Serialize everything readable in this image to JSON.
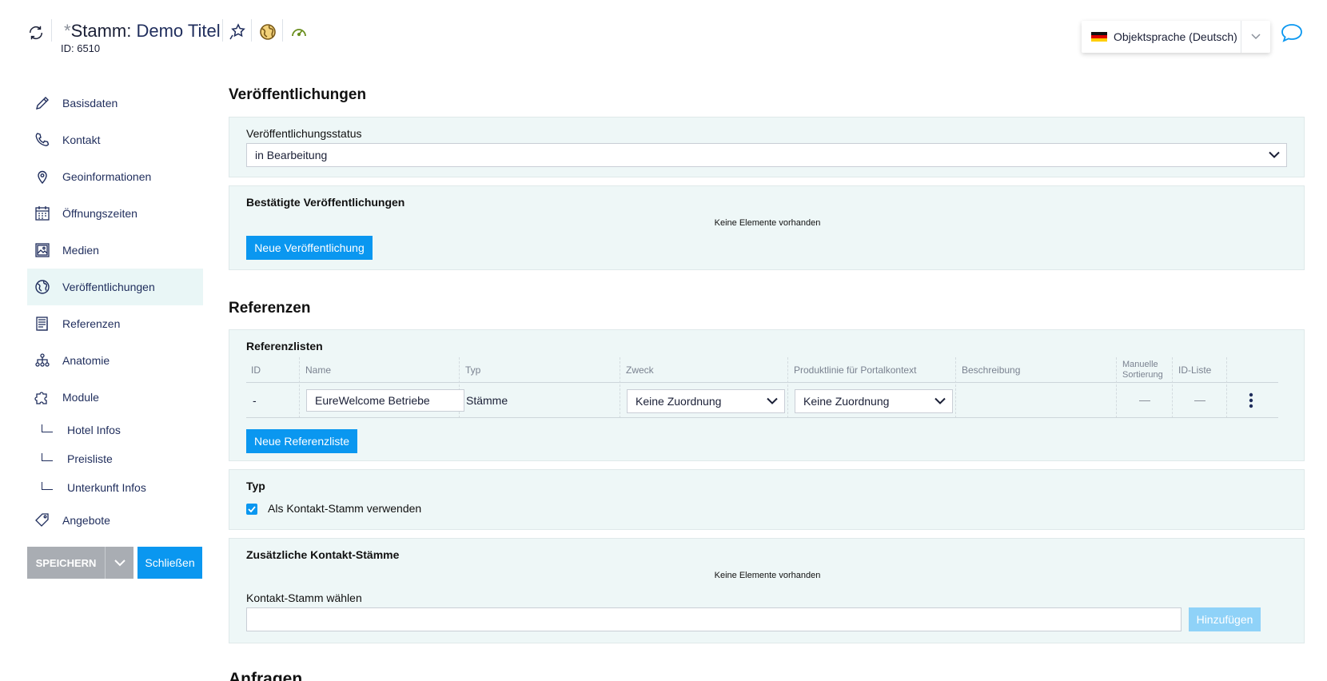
{
  "header": {
    "title_prefix": "Stamm:",
    "title": "Demo Titel",
    "id_label": "ID: 6510",
    "language": "Objektsprache (Deutsch)",
    "icons": [
      "refresh-icon",
      "star-pin-icon",
      "globe-icon",
      "speedometer-icon",
      "chat-icon"
    ]
  },
  "sidebar": {
    "items": [
      {
        "label": "Basisdaten",
        "icon": "pencil-icon"
      },
      {
        "label": "Kontakt",
        "icon": "phone-icon"
      },
      {
        "label": "Geoinformationen",
        "icon": "map-pin-icon"
      },
      {
        "label": "Öffnungszeiten",
        "icon": "calendar-icon"
      },
      {
        "label": "Medien",
        "icon": "image-icon"
      },
      {
        "label": "Veröffentlichungen",
        "icon": "globe-icon",
        "active": true
      },
      {
        "label": "Referenzen",
        "icon": "document-icon"
      },
      {
        "label": "Anatomie",
        "icon": "hierarchy-icon"
      },
      {
        "label": "Module",
        "icon": "puzzle-icon"
      }
    ],
    "sub_items": [
      "Hotel Infos",
      "Preisliste",
      "Unterkunft Infos"
    ],
    "last_item": {
      "label": "Angebote",
      "icon": "tag-icon"
    },
    "save_label": "SPEICHERN",
    "close_label": "Schließen"
  },
  "publications": {
    "title": "Veröffentlichungen",
    "status_label": "Veröffentlichungsstatus",
    "status_value": "in Bearbeitung",
    "confirmed_label": "Bestätigte Veröffentlichungen",
    "empty_text": "Keine Elemente vorhanden",
    "new_button": "Neue Veröffentlichung"
  },
  "references": {
    "title": "Referenzen",
    "lists_label": "Referenzlisten",
    "columns": [
      "ID",
      "Name",
      "Typ",
      "Zweck",
      "Produktlinie für Portalkontext",
      "Beschreibung",
      "Manuelle Sortierung",
      "ID-Liste"
    ],
    "row": {
      "id": "-",
      "name": "EureWelcome Betriebe",
      "typ": "Stämme",
      "zweck": "Keine Zuordnung",
      "produktlinie": "Keine Zuordnung",
      "beschreibung": ""
    },
    "new_button": "Neue Referenzliste"
  },
  "type_panel": {
    "label": "Typ",
    "checkbox_label": "Als Kontakt-Stamm verwenden",
    "checked": true
  },
  "contacts_panel": {
    "label": "Zusätzliche Kontakt-Stämme",
    "empty_text": "Keine Elemente vorhanden",
    "choose_label": "Kontakt-Stamm wählen",
    "input_value": "",
    "add_button": "Hinzufügen"
  },
  "next_section_title": "Anfragen",
  "colors": {
    "accent": "#0a97f0",
    "panel_bg": "#eef7f7",
    "active_nav": "#e9f6f6",
    "save_disabled": "#a9adb3"
  }
}
